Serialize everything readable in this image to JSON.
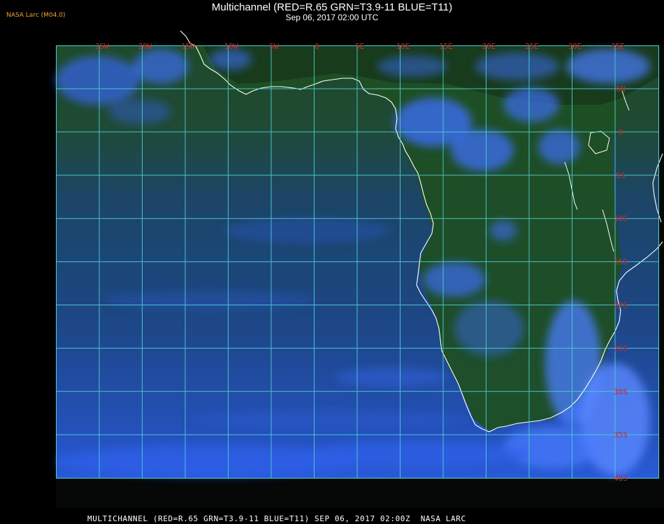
{
  "header": {
    "tag": "NASA Larc (M04.0)",
    "title": "Multichannel (RED=R.65 GRN=T3.9-11 BLUE=T11)",
    "subtitle": "Sep 06, 2017 02:00 UTC"
  },
  "footer": {
    "text": "MULTICHANNEL (RED=R.65 GRN=T3.9-11 BLUE=T11) SEP 06, 2017 02:00Z  NASA LARC"
  },
  "map": {
    "longitude_labels": [
      "25W",
      "20W",
      "15W",
      "10W",
      "5W",
      "0",
      "5E",
      "10E",
      "15E",
      "20E",
      "25E",
      "30E",
      "35E"
    ],
    "latitude_labels": [
      "5N",
      "0",
      "5S",
      "10S",
      "15S",
      "20S",
      "25S",
      "30S",
      "35S",
      "40S"
    ],
    "longitude_range": [
      -30,
      35
    ],
    "latitude_range": [
      10,
      -40
    ],
    "grid": true,
    "colors": {
      "grid": "#4fd0d6",
      "labels": "#cc2b2b",
      "coastline": "#ffffff",
      "ocean": "#1a3d8f",
      "land": "#1e4a22",
      "cloud": "#3f78ff"
    }
  }
}
